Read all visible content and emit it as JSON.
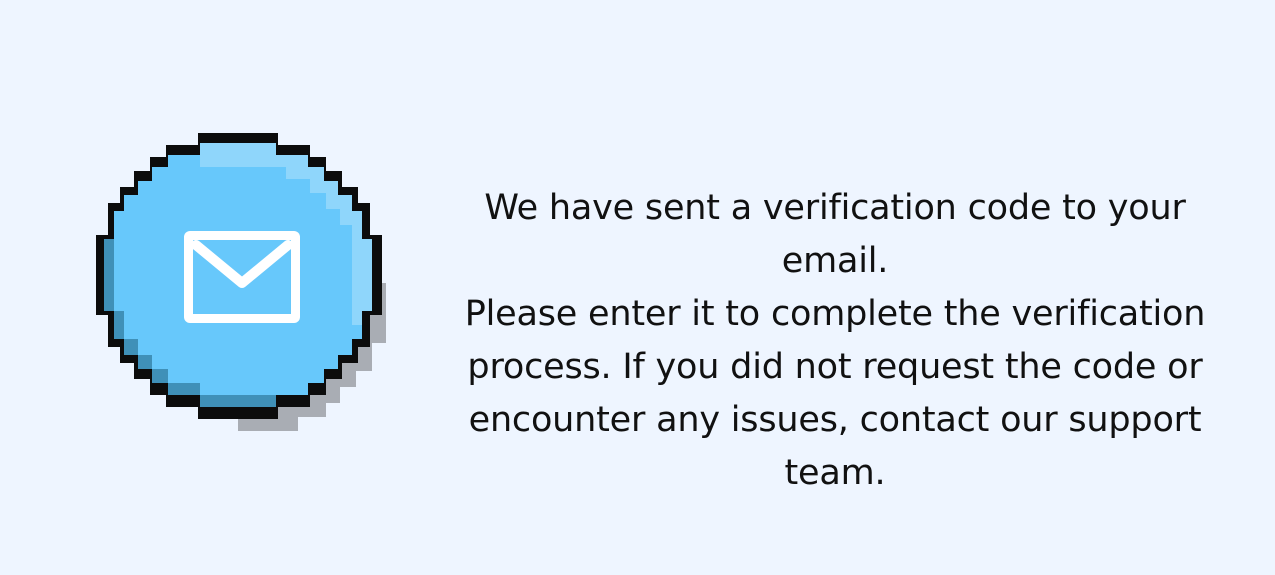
{
  "colors": {
    "background": "#eef5ff",
    "badge_fill": "#67c8fb",
    "badge_light_edge": "#8fd6fb",
    "badge_shadow": "#a9adb4",
    "badge_outline": "#0c0c0c",
    "mail_icon": "#ffffff"
  },
  "icon": {
    "name": "mail-icon",
    "badge_style": "pixel-art-circle"
  },
  "message": {
    "text": "We have sent a verification code to your email.\nPlease enter it to complete the verification\nprocess. If you did not request the code or\nencounter any issues, contact our support team."
  }
}
